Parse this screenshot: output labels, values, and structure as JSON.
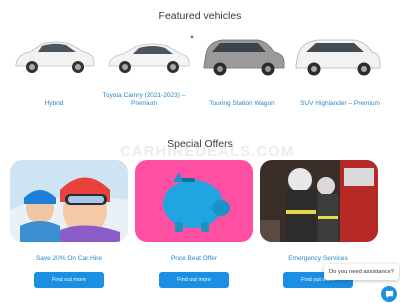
{
  "featured": {
    "title": "Featured vehicles",
    "cars": [
      {
        "label": "Hybrid",
        "color": "#f2f2f2"
      },
      {
        "label": "Toyota Camry (2021-2023) – Premium",
        "color": "#f4f4f4"
      },
      {
        "label": "Touring Station Wagon",
        "color": "#9a9a9a"
      },
      {
        "label": "SUV Highlander – Premium",
        "color": "#f2f2f2"
      }
    ]
  },
  "offers": {
    "title": "Special Offers",
    "items": [
      {
        "label": "Save 20% On Car Hire",
        "button": "Find out more"
      },
      {
        "label": "Price Beat Offer",
        "button": "Find out more"
      },
      {
        "label": "Emergency Services",
        "button": "Find out more"
      }
    ]
  },
  "assist": {
    "text": "Do you need assistance?"
  },
  "colors": {
    "accent": "#1a8fe3",
    "link": "#2a86c8",
    "piggy_bg": "#ff4fa3",
    "piggy": "#1fa6e0"
  }
}
